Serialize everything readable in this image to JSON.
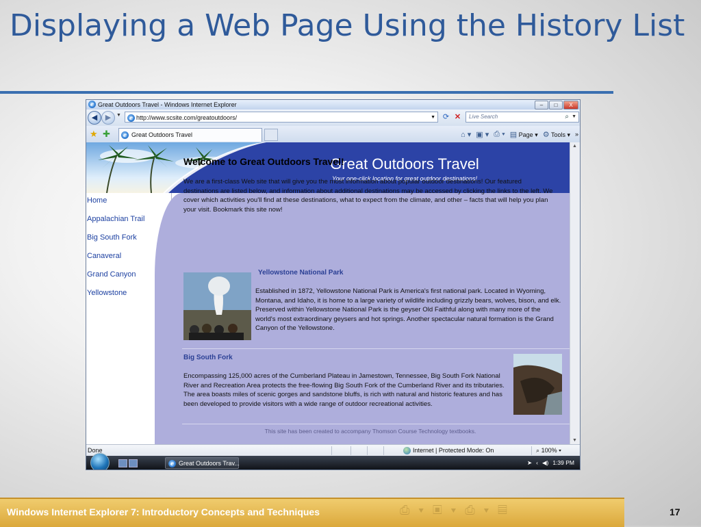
{
  "slide": {
    "title": "Displaying a Web Page Using the History List",
    "footer": "Windows Internet Explorer 7: Introductory Concepts and Techniques",
    "page_number": "17"
  },
  "browser": {
    "window_title": "Great Outdoors Travel - Windows Internet Explorer",
    "window_buttons": [
      "–",
      "□",
      "X"
    ],
    "address_url": "http://www.scsite.com/greatoutdoors/",
    "search_placeholder": "Live Search",
    "tab_title": "Great Outdoors Travel",
    "command_bar": {
      "page_label": "Page",
      "tools_label": "Tools",
      "more": "»"
    },
    "status": {
      "text": "Done",
      "zone": "Internet | Protected Mode: On",
      "zoom": "100%"
    }
  },
  "taskbar": {
    "window_button": "Great Outdoors Trav...",
    "clock": "1:39 PM"
  },
  "website": {
    "header_title": "Great Outdoors Travel",
    "header_tagline": "Your one-click location for great outdoor destinations!",
    "nav": [
      "Home",
      "Appalachian Trail",
      "Big South Fork",
      "Canaveral",
      "Grand Canyon",
      "Yellowstone"
    ],
    "welcome_heading": "Welcome to Great Outdoors Travel!",
    "intro": "We are a first-class Web site that will give you the most information about popular outdoor destinations! Our featured destinations are listed below, and information about additional destinations may be accessed by clicking the links to the left. We cover which activities you'll find at these destinations, what to expect from the climate, and other – facts that will help you plan your visit. Bookmark this site now!",
    "sections": [
      {
        "title": "Yellowstone National Park",
        "text": "Established in 1872, Yellowstone National Park is America's first national park. Located in Wyoming, Montana, and Idaho, it is home to a large variety of wildlife including grizzly bears, wolves, bison, and elk. Preserved within Yellowstone National Park is the geyser Old Faithful along with many more of the world's most extraordinary geysers and hot springs. Another spectacular natural formation is the Grand Canyon of the Yellowstone."
      },
      {
        "title": "Big South Fork",
        "text": "Encompassing 125,000 acres of the Cumberland Plateau in Jamestown, Tennessee, Big South Fork National River and Recreation Area protects the free-flowing Big South Fork of the Cumberland River and its tributaries. The area boasts miles of scenic gorges and sandstone bluffs, is rich with natural and historic features and has been developed to provide visitors with a wide range of outdoor recreational activities."
      }
    ],
    "footer_note": "This site has been created to accompany Thomson Course Technology textbooks."
  },
  "colors": {
    "title_blue": "#2f5a9a",
    "site_header_blue": "#2c43a6",
    "content_lavender": "#aeaedc",
    "footer_gold": "#dba83b"
  }
}
